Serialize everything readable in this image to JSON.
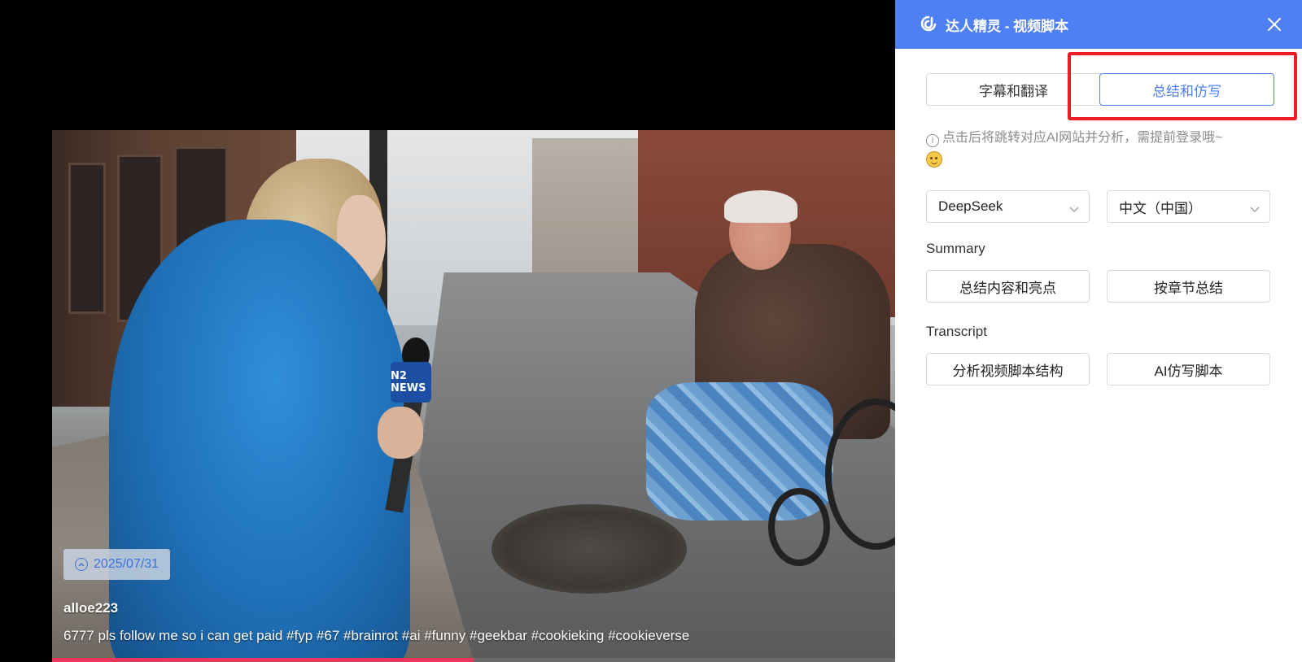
{
  "video": {
    "date": "2025/07/31",
    "author": "alloe223",
    "caption": "6777 pls follow me so i can get paid #fyp #67 #brainrot #ai #funny #geekbar #cookieking #cookieverse",
    "mic_flag_text": "N2 NEWS",
    "progress_fraction": 0.5
  },
  "panel": {
    "title": "达人精灵 - 视频脚本",
    "tabs": [
      {
        "label": "字幕和翻译",
        "active": false
      },
      {
        "label": "总结和仿写",
        "active": true
      }
    ],
    "hint": "点击后将跳转对应AI网站并分析，需提前登录哦~",
    "model_select": {
      "value": "DeepSeek"
    },
    "language_select": {
      "value": "中文（中国）"
    },
    "summary": {
      "label": "Summary",
      "buttons": [
        "总结内容和亮点",
        "按章节总结"
      ]
    },
    "transcript": {
      "label": "Transcript",
      "buttons": [
        "分析视频脚本结构",
        "AI仿写脚本"
      ]
    }
  },
  "colors": {
    "accent": "#4e7ff3",
    "highlight": "#ec1c24",
    "progress": "#e8365d"
  },
  "icons": {
    "logo": "app-logo-icon",
    "close": "close-icon",
    "info": "info-icon",
    "emoji": "smiling-face-emoji",
    "chevron": "chevron-down-icon",
    "date": "chevron-up-circle-icon"
  }
}
